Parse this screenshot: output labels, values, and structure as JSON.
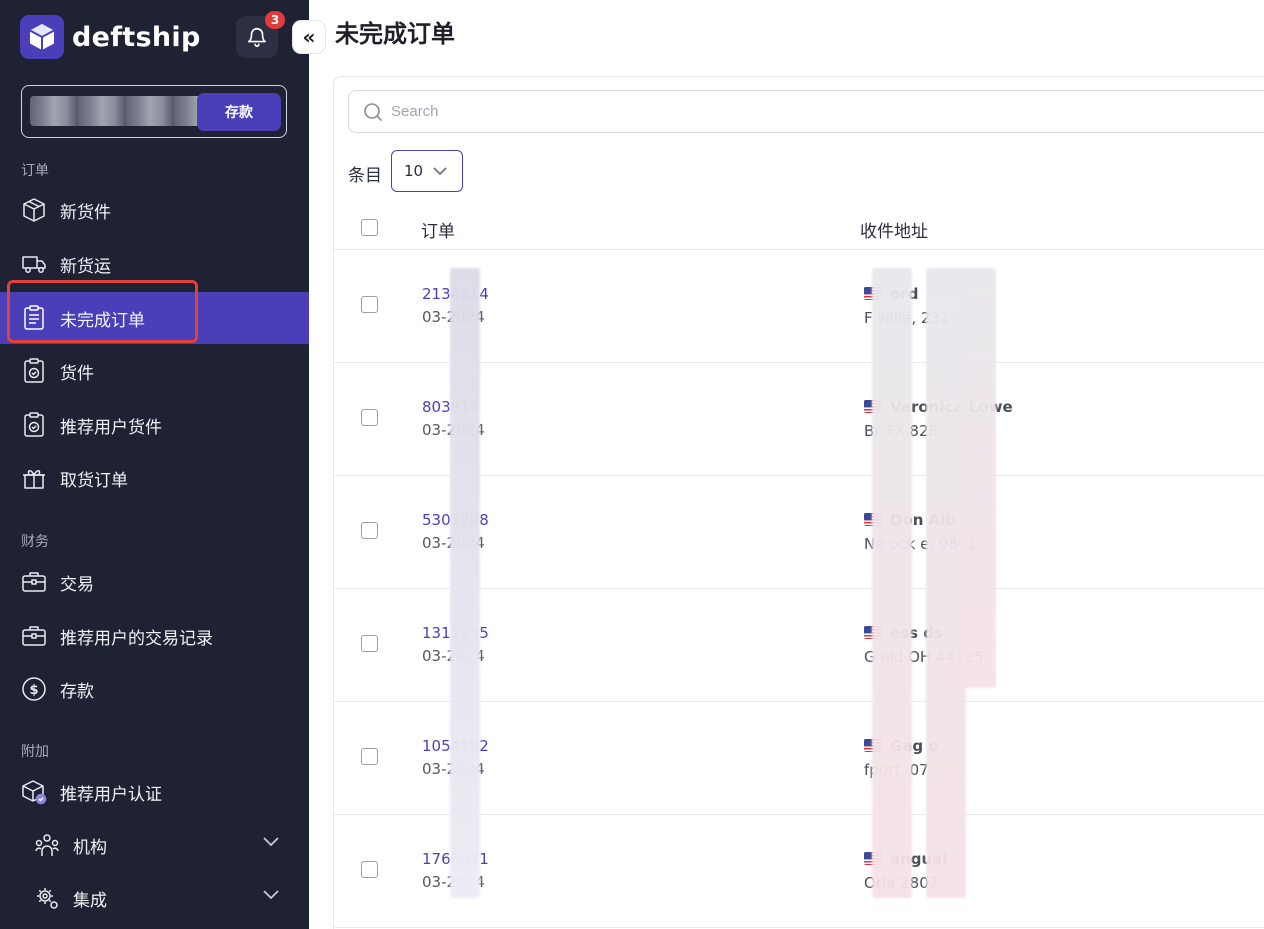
{
  "brand": {
    "name": "deftship",
    "color": "#4a3fb8"
  },
  "notifications": {
    "count": "3"
  },
  "sidebar": {
    "collapse_glyph": "«",
    "balance": {
      "deposit_label": "存款"
    },
    "sections": {
      "orders": "订单",
      "finance": "财务",
      "extra": "附加"
    },
    "items": {
      "new_shipment": "新货件",
      "new_freight": "新货运",
      "incomplete_orders": "未完成订单",
      "shipments": "货件",
      "referral_shipments": "推荐用户货件",
      "pickup_orders": "取货订单",
      "transactions": "交易",
      "referral_transactions": "推荐用户的交易记录",
      "deposit": "存款",
      "referral_verification": "推荐用户认证",
      "organization": "机构",
      "integrations": "集成"
    },
    "active_item": "incomplete_orders"
  },
  "main": {
    "title": "未完成订单",
    "search": {
      "placeholder": "Search"
    },
    "entries": {
      "label": "条目",
      "value": "10"
    },
    "columns": {
      "order": "订单",
      "address": "收件地址"
    },
    "rows": [
      {
        "order_no": "2134614",
        "date": "03-2024",
        "name": "ord",
        "address": "F wille, 231"
      },
      {
        "order_no": "803915",
        "date": "03-2024",
        "name": "Veronica Lowe",
        "address": "Br TX 828"
      },
      {
        "order_no": "5303208",
        "date": "03-2024",
        "name": "Don Alb",
        "address": "Ne ock e, 0801"
      },
      {
        "order_no": "1311955",
        "date": "03-2024",
        "name": "ess ds",
        "address": "G eld OH 44125"
      },
      {
        "order_no": "1054162",
        "date": "03-2024",
        "name": "Gag o",
        "address": "fport, 07"
      },
      {
        "order_no": "1766071",
        "date": "03-2024",
        "name": "angual",
        "address": "Orla 2807"
      }
    ]
  }
}
